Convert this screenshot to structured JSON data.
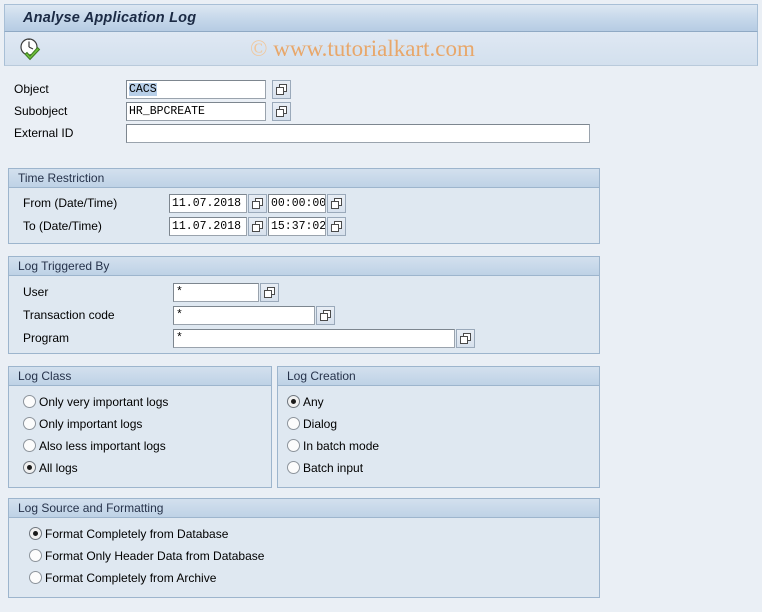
{
  "window": {
    "title": "Analyse Application Log"
  },
  "toolbar": {
    "execute_icon": "execute-clock-check-icon",
    "execute_tooltip": "Execute"
  },
  "watermark": {
    "copyright": "©",
    "text": "www.tutorialkart.com"
  },
  "selection_fields": {
    "object": {
      "label": "Object",
      "value": "CACS",
      "value_selected": true,
      "has_value_help": true
    },
    "subobject": {
      "label": "Subobject",
      "value": "HR_BPCREATE",
      "has_value_help": true
    },
    "external_id": {
      "label": "External ID",
      "value": "",
      "has_value_help": false
    }
  },
  "time_restriction": {
    "title": "Time Restriction",
    "from": {
      "label": "From (Date/Time)",
      "date": "11.07.2018",
      "time": "00:00:00"
    },
    "to": {
      "label": "To (Date/Time)",
      "date": "11.07.2018",
      "time": "15:37:02"
    }
  },
  "log_triggered_by": {
    "title": "Log Triggered By",
    "user": {
      "label": "User",
      "value": "*"
    },
    "transaction_code": {
      "label": "Transaction code",
      "value": "*"
    },
    "program": {
      "label": "Program",
      "value": "*"
    }
  },
  "log_class": {
    "title": "Log Class",
    "options": [
      {
        "label": "Only very important logs",
        "selected": false
      },
      {
        "label": "Only important logs",
        "selected": false
      },
      {
        "label": "Also less important logs",
        "selected": false
      },
      {
        "label": "All logs",
        "selected": true
      }
    ]
  },
  "log_creation": {
    "title": "Log Creation",
    "options": [
      {
        "label": "Any",
        "selected": true
      },
      {
        "label": "Dialog",
        "selected": false
      },
      {
        "label": "In batch mode",
        "selected": false
      },
      {
        "label": "Batch input",
        "selected": false
      }
    ]
  },
  "log_source": {
    "title": "Log Source and Formatting",
    "options": [
      {
        "label": "Format Completely from Database",
        "selected": true
      },
      {
        "label": "Format Only Header Data from Database",
        "selected": false
      },
      {
        "label": "Format Completely from Archive",
        "selected": false
      }
    ]
  },
  "colors": {
    "page_background": "#eaeff5",
    "title_bar": "#c5d7ea",
    "group_background": "#dfe8f1",
    "group_header": "#bed2e6",
    "border": "#9db5cd",
    "watermark": "#e8a76a",
    "selection_highlight": "#b8cfe8"
  }
}
